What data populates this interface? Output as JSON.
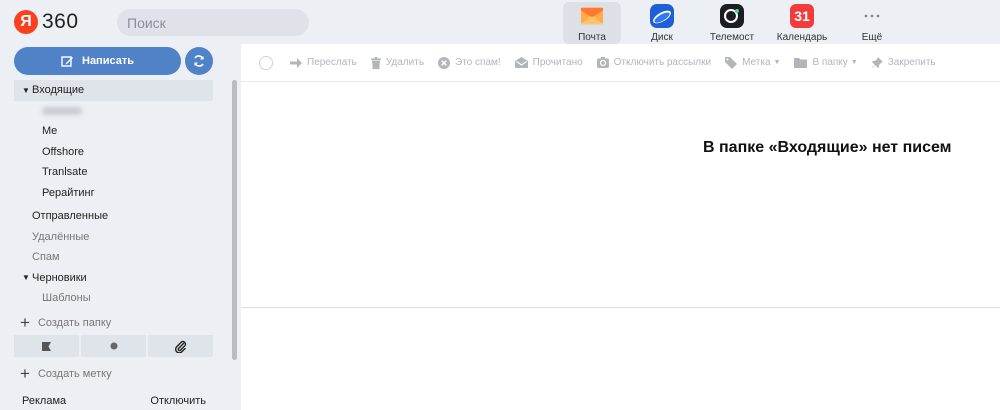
{
  "header": {
    "logo_letter": "Я",
    "logo_text": "360",
    "search_placeholder": "Поиск",
    "apps": [
      {
        "label": "Почта",
        "icon": "mail-envelope-icon",
        "active": true
      },
      {
        "label": "Диск",
        "icon": "disk-icon",
        "active": false
      },
      {
        "label": "Телемост",
        "icon": "telemost-camera-icon",
        "active": false
      },
      {
        "label": "Календарь",
        "icon": "calendar-icon",
        "active": false,
        "day": "31"
      },
      {
        "label": "Ещё",
        "icon": "more-dots-icon",
        "active": false
      }
    ]
  },
  "sidebar": {
    "compose_label": "Написать",
    "folders": [
      {
        "label": "Входящие",
        "level": 0,
        "triangle": true,
        "active": true
      },
      {
        "label": "",
        "level": 1,
        "blurred": true
      },
      {
        "label": "Me",
        "level": 1
      },
      {
        "label": "Offshore",
        "level": 1
      },
      {
        "label": "Tranlsate",
        "level": 1
      },
      {
        "label": "Рерайтинг",
        "level": 1
      },
      {
        "label": "Отправленные",
        "level": 0
      },
      {
        "label": "Удалённые",
        "level": 0,
        "muted": true
      },
      {
        "label": "Спам",
        "level": 0,
        "muted": true
      },
      {
        "label": "Черновики",
        "level": 0,
        "triangle": true
      },
      {
        "label": "Шаблоны",
        "level": 1,
        "muted": true
      }
    ],
    "create_folder": "Создать папку",
    "create_label": "Создать метку",
    "ad_label": "Реклама",
    "ad_disable": "Отключить"
  },
  "toolbar": {
    "forward": "Переслать",
    "delete": "Удалить",
    "spam": "Это спам!",
    "read": "Прочитано",
    "unsubscribe": "Отключить рассылки",
    "label": "Метка",
    "to_folder": "В папку",
    "pin": "Закрепить"
  },
  "main": {
    "empty_message": "В папке «Входящие» нет писем"
  },
  "colors": {
    "accent": "#4f82c7",
    "logo_red": "#fc3f1d",
    "background": "#eceff3",
    "toolbar_disabled": "#b2b5ba"
  }
}
